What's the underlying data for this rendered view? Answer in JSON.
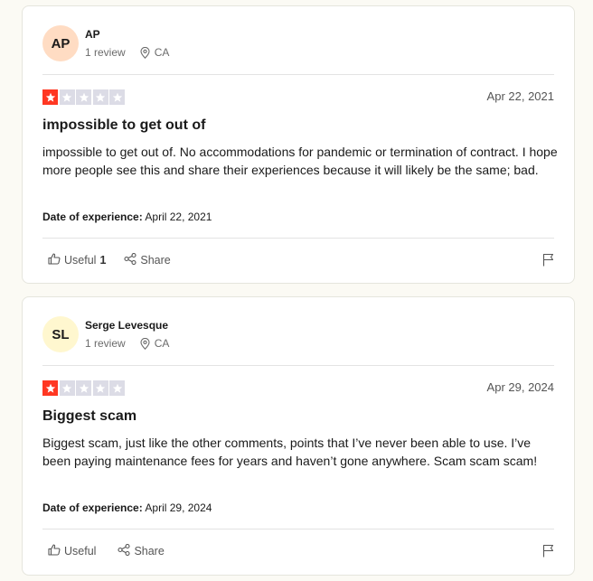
{
  "colors": {
    "star_on": "#ff3722",
    "star_off": "#dcdce6",
    "avatar_0": "#ffdcc3",
    "avatar_1": "#fff7cf"
  },
  "reviews": [
    {
      "initials": "AP",
      "author": "AP",
      "review_count": "1 review",
      "country": "CA",
      "rating": 1,
      "date": "Apr 22, 2021",
      "title": "impossible to get out of",
      "body": "impossible to get out of. No accommodations for pandemic or termination of contract. I hope more people see this and share their experiences because it will likely be the same; bad.",
      "experience_label": "Date of experience:",
      "experience_date": "April 22, 2021",
      "useful_label": "Useful",
      "useful_count": "1",
      "share_label": "Share"
    },
    {
      "initials": "SL",
      "author": "Serge Levesque",
      "review_count": "1 review",
      "country": "CA",
      "rating": 1,
      "date": "Apr 29, 2024",
      "title": "Biggest scam",
      "body": "Biggest scam, just like the other comments, points that I’ve never been able to use. I’ve been paying maintenance fees for years and haven’t gone anywhere. Scam scam scam!",
      "experience_label": "Date of experience:",
      "experience_date": "April 29, 2024",
      "useful_label": "Useful",
      "useful_count": "",
      "share_label": "Share"
    }
  ]
}
